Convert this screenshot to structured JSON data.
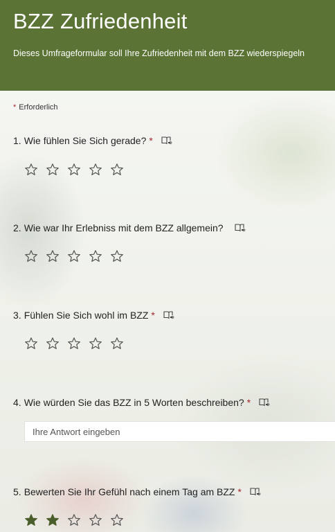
{
  "header": {
    "title": "BZZ Zufriedenheit",
    "subtitle": "Dieses Umfrageformular soll Ihre Zufriedenheit mit dem BZZ wiederspiegeln",
    "background_color": "#5b7335"
  },
  "form": {
    "required_marker": "*",
    "required_text": "Erforderlich",
    "questions": [
      {
        "number": "1.",
        "text": "Wie fühlen Sie Sich gerade?",
        "required": "*",
        "type": "rating",
        "rating": 0,
        "max": 5
      },
      {
        "number": "2.",
        "text": "Wie war Ihr Erlebniss mit dem BZZ allgemein?",
        "required": "",
        "type": "rating",
        "rating": 0,
        "max": 5
      },
      {
        "number": "3.",
        "text": "Fühlen Sie Sich wohl im BZZ",
        "required": "*",
        "type": "rating",
        "rating": 0,
        "max": 5
      },
      {
        "number": "4.",
        "text": "Wie würden Sie das BZZ in 5 Worten beschreiben?",
        "required": "*",
        "type": "text",
        "placeholder": "Ihre Antwort eingeben",
        "value": ""
      },
      {
        "number": "5.",
        "text": "Bewerten Sie Ihr Gefühl nach einem Tag am BZZ",
        "required": "*",
        "type": "rating",
        "rating": 2,
        "max": 5
      }
    ]
  },
  "icons": {
    "rating_star": "star-icon",
    "immersive_reader": "immersive-reader-icon"
  },
  "colors": {
    "accent": "#5b7335",
    "required": "#a4262c",
    "star_outline": "#555555",
    "star_filled": "#4a5e2b"
  }
}
